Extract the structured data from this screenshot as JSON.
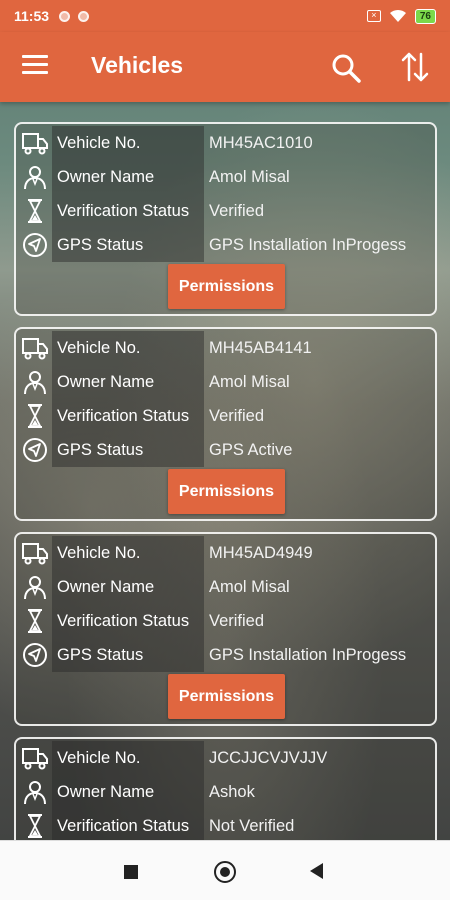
{
  "status_bar": {
    "time": "11:53",
    "battery": "76"
  },
  "app_bar": {
    "title": "Vehicles",
    "menu_icon": "hamburger-menu-icon",
    "search_icon": "search-icon",
    "sort_icon": "sort-arrows-icon"
  },
  "labels": {
    "vehicle_no": "Vehicle No.",
    "owner_name": "Owner Name",
    "verification_status": "Verification Status",
    "gps_status": "GPS Status",
    "permissions_button": "Permissions"
  },
  "vehicles": [
    {
      "vehicle_no": "MH45AC1010",
      "owner_name": "Amol Misal",
      "verification_status": "Verified",
      "gps_status": "GPS Installation InProgess"
    },
    {
      "vehicle_no": "MH45AB4141",
      "owner_name": "Amol Misal",
      "verification_status": "Verified",
      "gps_status": "GPS Active"
    },
    {
      "vehicle_no": "MH45AD4949",
      "owner_name": "Amol Misal",
      "verification_status": "Verified",
      "gps_status": "GPS Installation InProgess"
    },
    {
      "vehicle_no": "JCCJJCVJVJJV",
      "owner_name": "Ashok",
      "verification_status": "Not Verified",
      "gps_status": ""
    }
  ],
  "colors": {
    "accent": "#e0663f",
    "nav_bar": "#fafafa"
  }
}
